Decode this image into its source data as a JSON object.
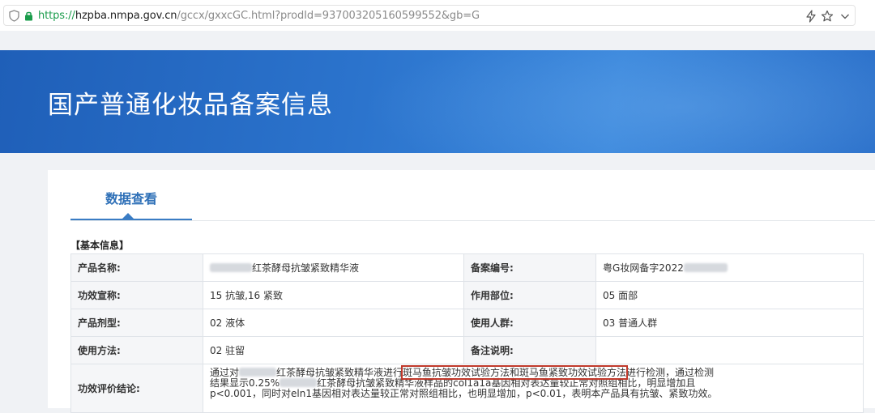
{
  "browser": {
    "url_proto": "https://",
    "url_host": "hzpba.nmpa.gov.cn",
    "url_path": "/gccx/gxxcGC.html?prodId=937003205160599552&gb=G"
  },
  "banner": {
    "title": "国产普通化妆品备案信息"
  },
  "tabs": [
    {
      "label": "数据查看"
    }
  ],
  "section_title": "【基本信息】",
  "rows": [
    {
      "k1": "产品名称:",
      "v1": "红茶酵母抗皱紧致精华液",
      "k2": "备案编号:",
      "v2": "粤G妆网备字2022"
    },
    {
      "k1": "功效宣称:",
      "v1": "15 抗皱,16 紧致",
      "k2": "作用部位:",
      "v2": "05 面部"
    },
    {
      "k1": "产品剂型:",
      "v1": "02 液体",
      "k2": "使用人群:",
      "v2": "03 普通人群"
    },
    {
      "k1": "使用方法:",
      "v1": "02 驻留",
      "k2": "备注说明:",
      "v2": ""
    }
  ],
  "conclusion": {
    "label": "功效评价结论:",
    "pre": "通过对",
    "mid1": "红茶酵母抗皱紧致精华液进行",
    "highlight": "斑马鱼抗皱功效试验方法和斑马鱼紧致功效试验方法",
    "post1": "进行检测，通过检测",
    "line2_pre": "结果显示0.25%",
    "line2_mid": "红茶酵母抗皱紧致精华液样品的col1a1a基因相对表达量较正常对照组相比，明显增加且",
    "line3": "p<0.001，同时对eln1基因相对表达量较正常对照组相比，也明显增加，p<0.01，表明本产品具有抗皱、紧致功效。"
  },
  "colors": {
    "banner": "#2b73cc",
    "tab": "#2d6fb7",
    "highlight_box": "#c0392b"
  }
}
